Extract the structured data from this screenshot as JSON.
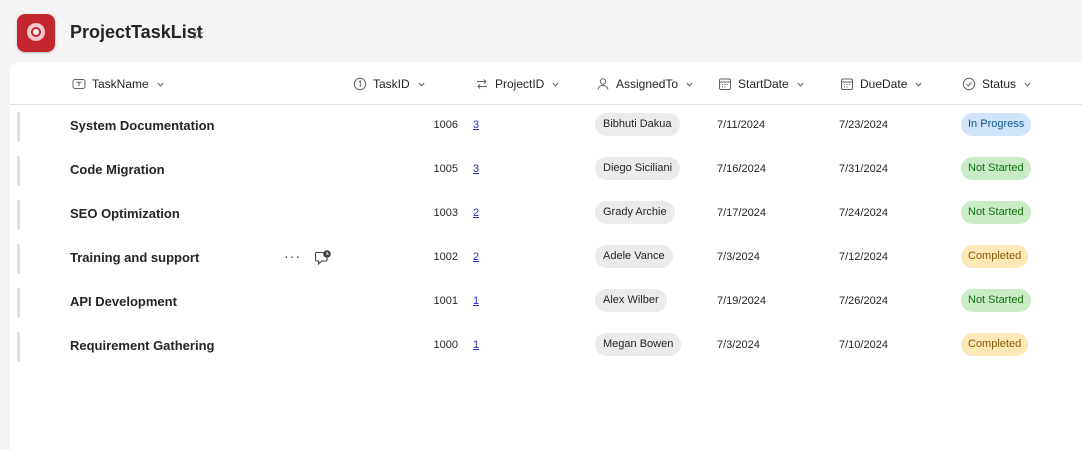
{
  "app": {
    "title": "ProjectTaskList",
    "brand_color": "#c4262e"
  },
  "columns": [
    {
      "label": "TaskName",
      "icon": "text-icon"
    },
    {
      "label": "TaskID",
      "icon": "number-icon"
    },
    {
      "label": "ProjectID",
      "icon": "lookup-icon"
    },
    {
      "label": "AssignedTo",
      "icon": "person-icon"
    },
    {
      "label": "StartDate",
      "icon": "calendar-icon"
    },
    {
      "label": "DueDate",
      "icon": "calendar-icon"
    },
    {
      "label": "Status",
      "icon": "choice-icon"
    }
  ],
  "rows": [
    {
      "name": "System Documentation",
      "id": "1006",
      "project": "3",
      "assigned": "Bibhuti Dakua",
      "start": "7/11/2024",
      "due": "7/23/2024",
      "status": "In Progress"
    },
    {
      "name": "Code Migration",
      "id": "1005",
      "project": "3",
      "assigned": "Diego Siciliani",
      "start": "7/16/2024",
      "due": "7/31/2024",
      "status": "Not Started"
    },
    {
      "name": "SEO Optimization",
      "id": "1003",
      "project": "2",
      "assigned": "Grady Archie",
      "start": "7/17/2024",
      "due": "7/24/2024",
      "status": "Not Started"
    },
    {
      "name": "Training and support",
      "id": "1002",
      "project": "2",
      "assigned": "Adele Vance",
      "start": "7/3/2024",
      "due": "7/12/2024",
      "status": "Completed"
    },
    {
      "name": "API Development",
      "id": "1001",
      "project": "1",
      "assigned": "Alex Wilber",
      "start": "7/19/2024",
      "due": "7/26/2024",
      "status": "Not Started"
    },
    {
      "name": "Requirement Gathering",
      "id": "1000",
      "project": "1",
      "assigned": "Megan Bowen",
      "start": "7/3/2024",
      "due": "7/10/2024",
      "status": "Completed"
    }
  ],
  "status_colors": {
    "In Progress": {
      "bg": "#cfe4fa",
      "fg": "#0f548c"
    },
    "Not Started": {
      "bg": "#c9ecc7",
      "fg": "#0e700e"
    },
    "Completed": {
      "bg": "#fce9b7",
      "fg": "#835b00"
    }
  }
}
